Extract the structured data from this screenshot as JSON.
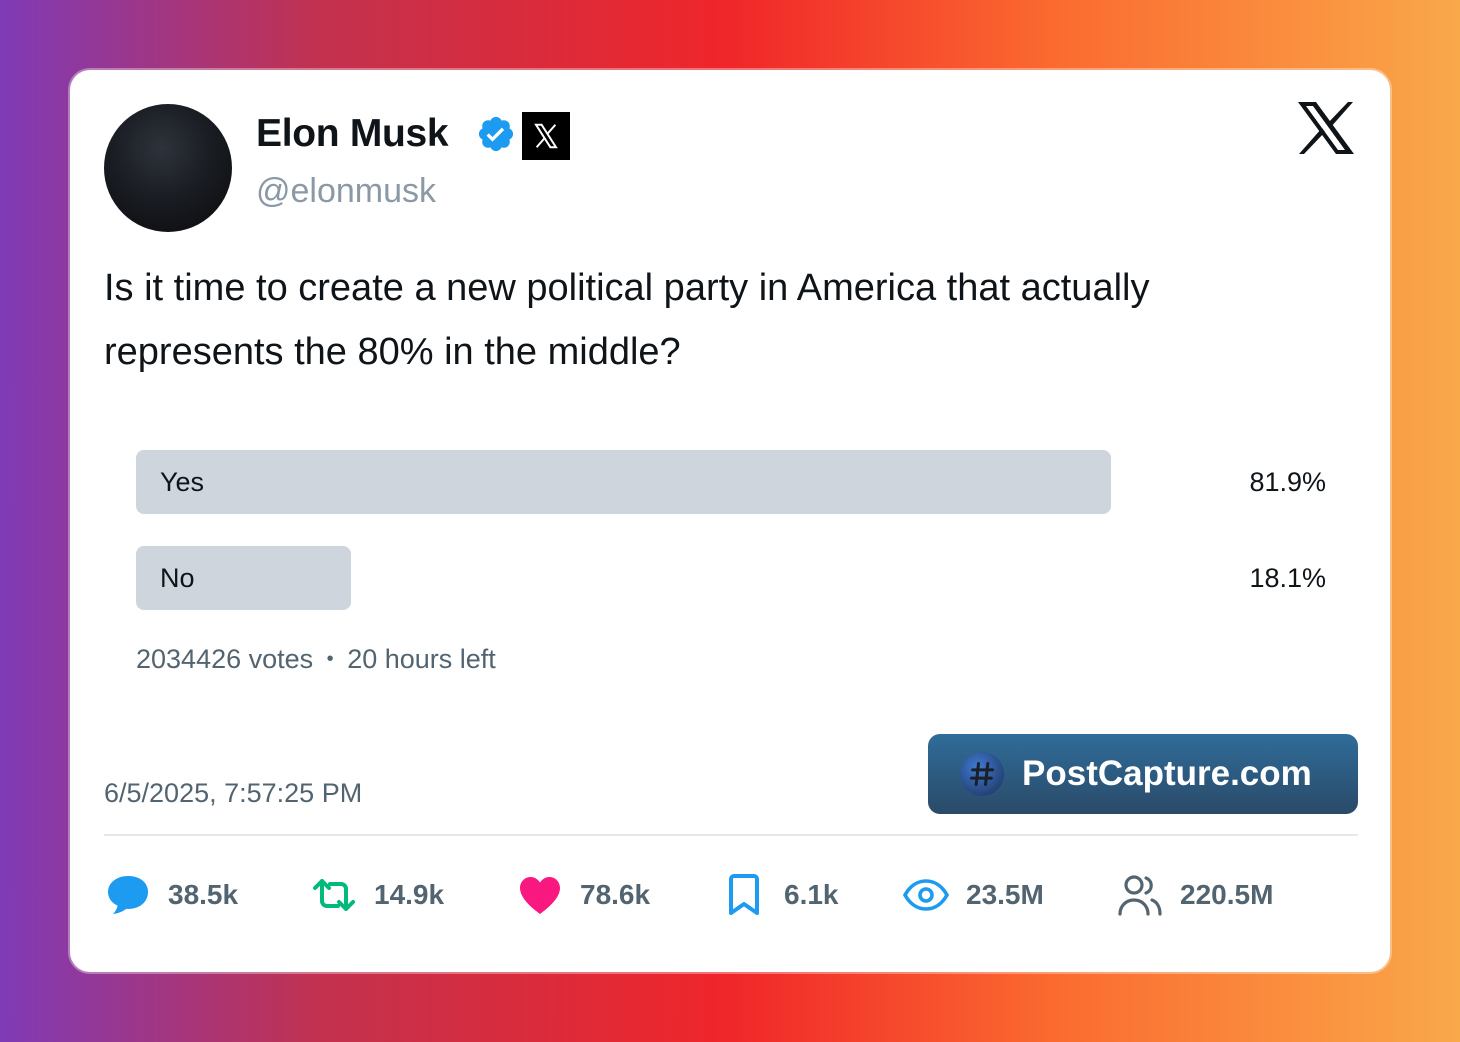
{
  "author": {
    "name": "Elon Musk",
    "handle": "@elonmusk",
    "verified": true
  },
  "tweet": {
    "text": "Is it time to create a new political party in America that actually represents the 80% in the middle?"
  },
  "poll": {
    "options": [
      {
        "label": "Yes",
        "percent": "81.9%",
        "fraction": 0.819
      },
      {
        "label": "No",
        "percent": "18.1%",
        "fraction": 0.181
      }
    ],
    "votes": "2034426 votes",
    "separator": "•",
    "time_left": "20 hours left"
  },
  "timestamp": "6/5/2025, 7:57:25 PM",
  "brand": {
    "label": "PostCapture.com"
  },
  "stats": {
    "replies": "38.5k",
    "reposts": "14.9k",
    "likes": "78.6k",
    "bookmarks": "6.1k",
    "views": "23.5M",
    "followers": "220.5M"
  },
  "colors": {
    "reply": "#1d9bf0",
    "repost": "#00ba7c",
    "like": "#f91880",
    "bookmark": "#1d9bf0",
    "views": "#1d9bf0",
    "followers": "#536471"
  },
  "icons": [
    "verified-badge-icon",
    "x-badge-icon",
    "x-logo-icon",
    "hashtag-icon",
    "reply-icon",
    "repost-icon",
    "like-icon",
    "bookmark-icon",
    "views-icon",
    "followers-icon"
  ]
}
